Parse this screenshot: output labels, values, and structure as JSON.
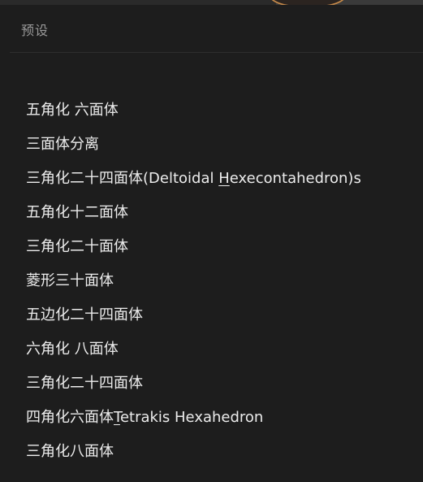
{
  "panel": {
    "title": "预设"
  },
  "presets": [
    {
      "label": "五角化 六面体"
    },
    {
      "label": "三面体分离"
    },
    {
      "label_pre": "三角化二十四面体(Deltoidal ",
      "label_u": "H",
      "label_post": "execontahedron)s"
    },
    {
      "label": "五角化十二面体"
    },
    {
      "label": "三角化二十面体"
    },
    {
      "label": "菱形三十面体"
    },
    {
      "label": "五边化二十四面体"
    },
    {
      "label": "六角化 八面体"
    },
    {
      "label": "三角化二十四面体"
    },
    {
      "label_pre": "四角化六面体",
      "label_u": "T",
      "label_post": "etrakis Hexahedron"
    },
    {
      "label": "三角化八面体"
    }
  ]
}
